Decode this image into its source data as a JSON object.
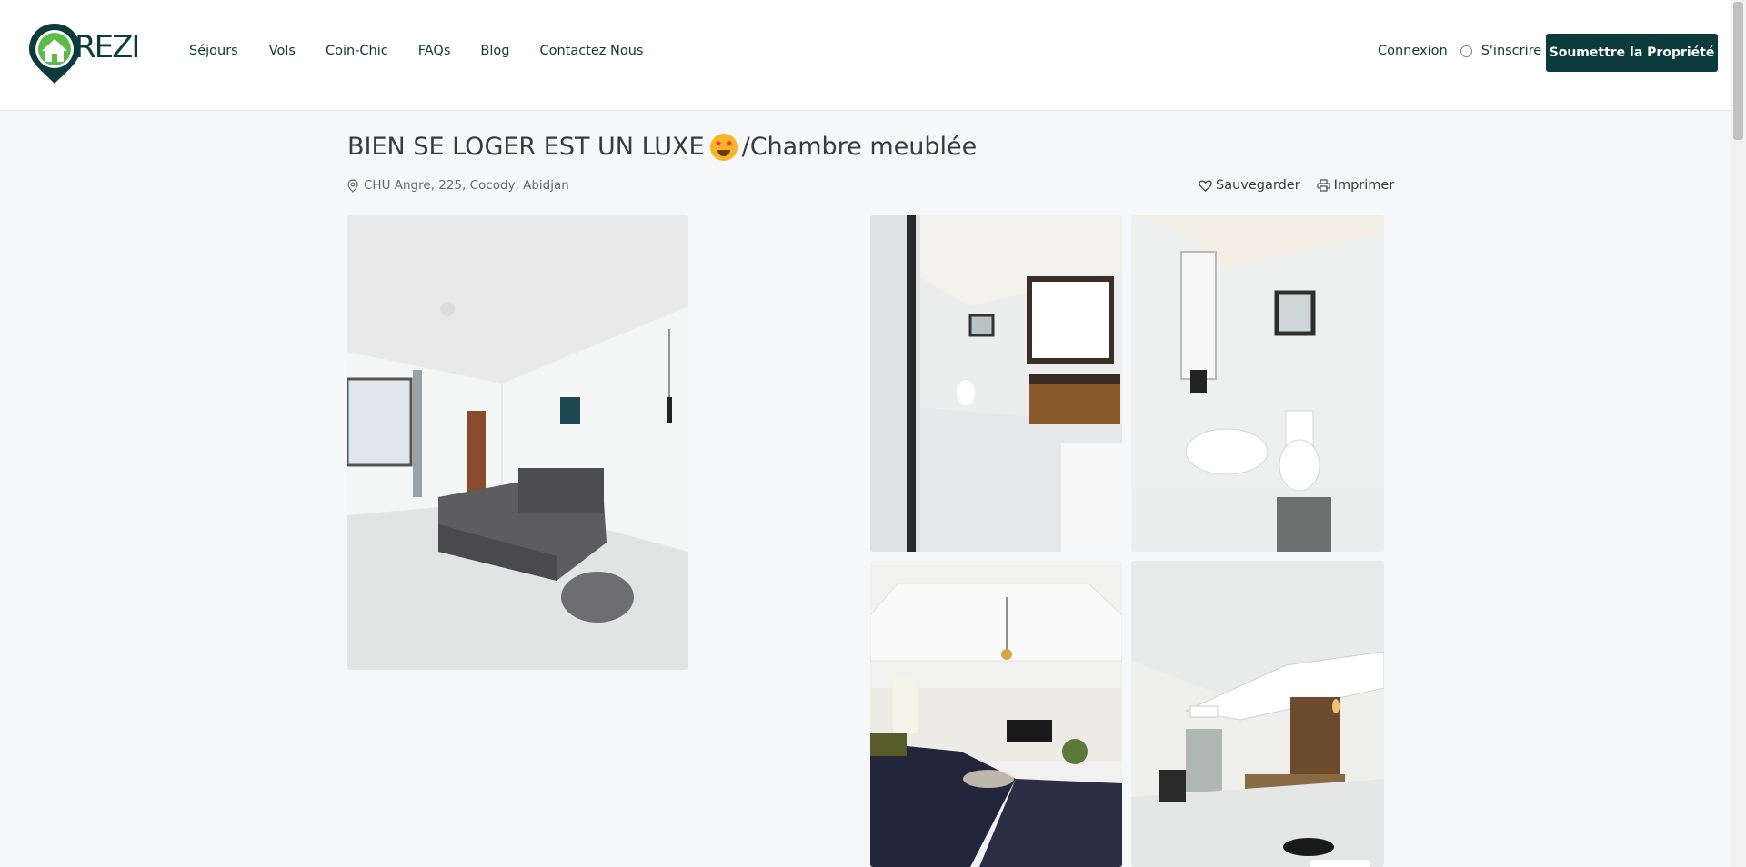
{
  "brand": {
    "logo_text": "REZI"
  },
  "nav": {
    "items": [
      "Séjours",
      "Vols",
      "Coin-Chic",
      "FAQs",
      "Blog",
      "Contactez Nous"
    ]
  },
  "auth": {
    "login": "Connexion",
    "signup": "S'inscrire"
  },
  "cta": {
    "submit_property": "Soumettre la Propriété"
  },
  "listing": {
    "title_before": "BIEN SE LOGER EST UN LUXE",
    "title_emoji": "star-struck-emoji",
    "title_after": "/Chambre meublée",
    "address": "CHU Angre, 225, Cocody, Abidjan",
    "save_label": "Sauvegarder",
    "print_label": "Imprimer"
  },
  "colors": {
    "brand_dark": "#0b3b3a",
    "brand_green": "#5dbb4a",
    "page_bg": "#f6f7f9"
  }
}
